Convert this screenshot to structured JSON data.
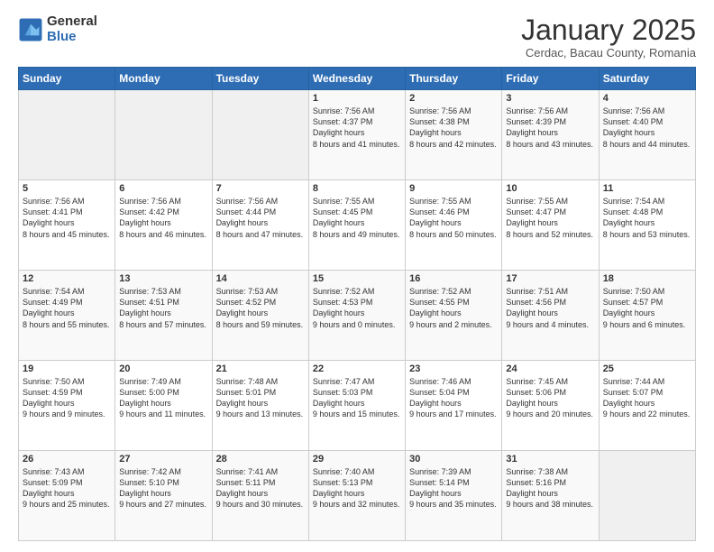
{
  "logo": {
    "general": "General",
    "blue": "Blue"
  },
  "header": {
    "title": "January 2025",
    "subtitle": "Cerdac, Bacau County, Romania"
  },
  "days_of_week": [
    "Sunday",
    "Monday",
    "Tuesday",
    "Wednesday",
    "Thursday",
    "Friday",
    "Saturday"
  ],
  "weeks": [
    [
      {
        "day": "",
        "empty": true
      },
      {
        "day": "",
        "empty": true
      },
      {
        "day": "",
        "empty": true
      },
      {
        "day": "1",
        "sunrise": "7:56 AM",
        "sunset": "4:37 PM",
        "daylight": "8 hours and 41 minutes."
      },
      {
        "day": "2",
        "sunrise": "7:56 AM",
        "sunset": "4:38 PM",
        "daylight": "8 hours and 42 minutes."
      },
      {
        "day": "3",
        "sunrise": "7:56 AM",
        "sunset": "4:39 PM",
        "daylight": "8 hours and 43 minutes."
      },
      {
        "day": "4",
        "sunrise": "7:56 AM",
        "sunset": "4:40 PM",
        "daylight": "8 hours and 44 minutes."
      }
    ],
    [
      {
        "day": "5",
        "sunrise": "7:56 AM",
        "sunset": "4:41 PM",
        "daylight": "8 hours and 45 minutes."
      },
      {
        "day": "6",
        "sunrise": "7:56 AM",
        "sunset": "4:42 PM",
        "daylight": "8 hours and 46 minutes."
      },
      {
        "day": "7",
        "sunrise": "7:56 AM",
        "sunset": "4:44 PM",
        "daylight": "8 hours and 47 minutes."
      },
      {
        "day": "8",
        "sunrise": "7:55 AM",
        "sunset": "4:45 PM",
        "daylight": "8 hours and 49 minutes."
      },
      {
        "day": "9",
        "sunrise": "7:55 AM",
        "sunset": "4:46 PM",
        "daylight": "8 hours and 50 minutes."
      },
      {
        "day": "10",
        "sunrise": "7:55 AM",
        "sunset": "4:47 PM",
        "daylight": "8 hours and 52 minutes."
      },
      {
        "day": "11",
        "sunrise": "7:54 AM",
        "sunset": "4:48 PM",
        "daylight": "8 hours and 53 minutes."
      }
    ],
    [
      {
        "day": "12",
        "sunrise": "7:54 AM",
        "sunset": "4:49 PM",
        "daylight": "8 hours and 55 minutes."
      },
      {
        "day": "13",
        "sunrise": "7:53 AM",
        "sunset": "4:51 PM",
        "daylight": "8 hours and 57 minutes."
      },
      {
        "day": "14",
        "sunrise": "7:53 AM",
        "sunset": "4:52 PM",
        "daylight": "8 hours and 59 minutes."
      },
      {
        "day": "15",
        "sunrise": "7:52 AM",
        "sunset": "4:53 PM",
        "daylight": "9 hours and 0 minutes."
      },
      {
        "day": "16",
        "sunrise": "7:52 AM",
        "sunset": "4:55 PM",
        "daylight": "9 hours and 2 minutes."
      },
      {
        "day": "17",
        "sunrise": "7:51 AM",
        "sunset": "4:56 PM",
        "daylight": "9 hours and 4 minutes."
      },
      {
        "day": "18",
        "sunrise": "7:50 AM",
        "sunset": "4:57 PM",
        "daylight": "9 hours and 6 minutes."
      }
    ],
    [
      {
        "day": "19",
        "sunrise": "7:50 AM",
        "sunset": "4:59 PM",
        "daylight": "9 hours and 9 minutes."
      },
      {
        "day": "20",
        "sunrise": "7:49 AM",
        "sunset": "5:00 PM",
        "daylight": "9 hours and 11 minutes."
      },
      {
        "day": "21",
        "sunrise": "7:48 AM",
        "sunset": "5:01 PM",
        "daylight": "9 hours and 13 minutes."
      },
      {
        "day": "22",
        "sunrise": "7:47 AM",
        "sunset": "5:03 PM",
        "daylight": "9 hours and 15 minutes."
      },
      {
        "day": "23",
        "sunrise": "7:46 AM",
        "sunset": "5:04 PM",
        "daylight": "9 hours and 17 minutes."
      },
      {
        "day": "24",
        "sunrise": "7:45 AM",
        "sunset": "5:06 PM",
        "daylight": "9 hours and 20 minutes."
      },
      {
        "day": "25",
        "sunrise": "7:44 AM",
        "sunset": "5:07 PM",
        "daylight": "9 hours and 22 minutes."
      }
    ],
    [
      {
        "day": "26",
        "sunrise": "7:43 AM",
        "sunset": "5:09 PM",
        "daylight": "9 hours and 25 minutes."
      },
      {
        "day": "27",
        "sunrise": "7:42 AM",
        "sunset": "5:10 PM",
        "daylight": "9 hours and 27 minutes."
      },
      {
        "day": "28",
        "sunrise": "7:41 AM",
        "sunset": "5:11 PM",
        "daylight": "9 hours and 30 minutes."
      },
      {
        "day": "29",
        "sunrise": "7:40 AM",
        "sunset": "5:13 PM",
        "daylight": "9 hours and 32 minutes."
      },
      {
        "day": "30",
        "sunrise": "7:39 AM",
        "sunset": "5:14 PM",
        "daylight": "9 hours and 35 minutes."
      },
      {
        "day": "31",
        "sunrise": "7:38 AM",
        "sunset": "5:16 PM",
        "daylight": "9 hours and 38 minutes."
      },
      {
        "day": "",
        "empty": true
      }
    ]
  ],
  "labels": {
    "sunrise": "Sunrise:",
    "sunset": "Sunset:",
    "daylight": "Daylight hours"
  }
}
